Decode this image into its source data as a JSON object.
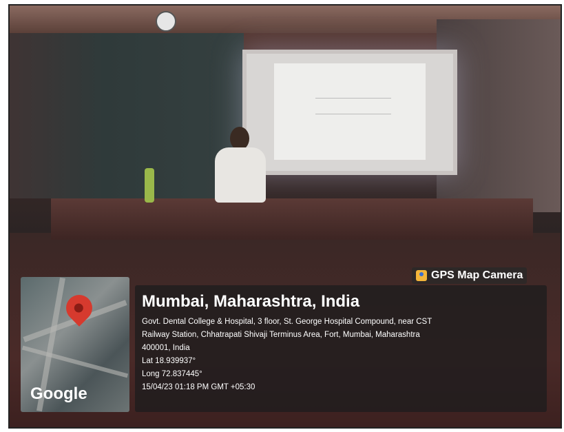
{
  "badge": {
    "label": "GPS Map Camera",
    "icon": "gps-map-camera-icon"
  },
  "map": {
    "brand": "Google",
    "pin_icon": "location-pin-icon"
  },
  "location": {
    "title": "Mumbai, Maharashtra, India",
    "address_line1": "Govt. Dental College & Hospital, 3 floor, St. George Hospital Compound, near CST",
    "address_line2": "Railway Station, Chhatrapati Shivaji Terminus Area, Fort, Mumbai, Maharashtra",
    "address_line3": "400001, India",
    "lat": "Lat 18.939937°",
    "long": "Long 72.837445°",
    "timestamp": "15/04/23 01:18 PM GMT +05:30"
  }
}
